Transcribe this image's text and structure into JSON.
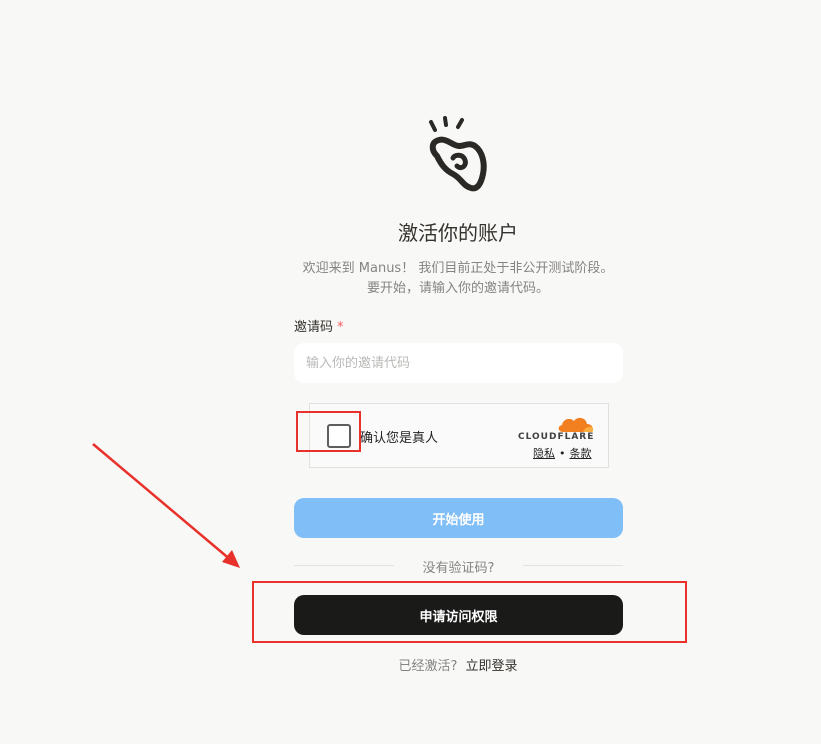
{
  "heading": {
    "title": "激活你的账户",
    "subtitle_line1": "欢迎来到 Manus！ 我们目前正处于非公开测试阶段。",
    "subtitle_line2": "要开始，请输入你的邀请代码。"
  },
  "form": {
    "code_label": "邀请码",
    "required_mark": "*",
    "code_placeholder": "输入你的邀请代码",
    "code_value": ""
  },
  "captcha": {
    "label": "确认您是真人",
    "brand": "CLOUDFLARE",
    "privacy_link": "隐私",
    "separator": "•",
    "terms_link": "条款",
    "checked": false
  },
  "actions": {
    "start_button": "开始使用",
    "no_code_text": "没有验证码?",
    "request_button": "申请访问权限"
  },
  "footer": {
    "already_text": "已经激活?",
    "login_link": "立即登录"
  },
  "colors": {
    "background": "#f8f8f7",
    "start_button": "#7fbef6",
    "request_button": "#1a1a19",
    "annotation": "#e8312a",
    "cloudflare_orange": "#f38020"
  },
  "icons": {
    "logo": "manus-hand-logo-icon",
    "cloudflare": "cloudflare-cloud-icon"
  }
}
